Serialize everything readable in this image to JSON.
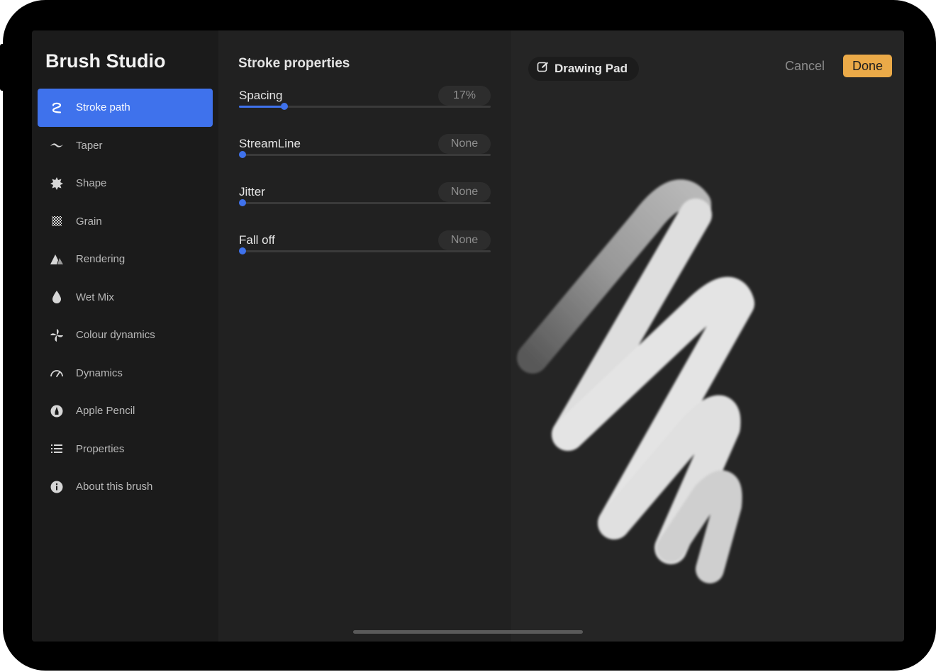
{
  "sidebar": {
    "title": "Brush Studio",
    "items": [
      {
        "label": "Stroke path",
        "icon": "stroke-path-icon",
        "active": true
      },
      {
        "label": "Taper",
        "icon": "taper-icon"
      },
      {
        "label": "Shape",
        "icon": "shape-icon"
      },
      {
        "label": "Grain",
        "icon": "grain-icon"
      },
      {
        "label": "Rendering",
        "icon": "rendering-icon"
      },
      {
        "label": "Wet Mix",
        "icon": "wet-mix-icon"
      },
      {
        "label": "Colour dynamics",
        "icon": "colour-dynamics-icon"
      },
      {
        "label": "Dynamics",
        "icon": "dynamics-icon"
      },
      {
        "label": "Apple Pencil",
        "icon": "apple-pencil-icon"
      },
      {
        "label": "Properties",
        "icon": "properties-icon"
      },
      {
        "label": "About this brush",
        "icon": "info-icon"
      }
    ]
  },
  "panel": {
    "title": "Stroke properties",
    "properties": [
      {
        "label": "Spacing",
        "value": "17%",
        "level": 0.18
      },
      {
        "label": "StreamLine",
        "value": "None",
        "level": 0
      },
      {
        "label": "Jitter",
        "value": "None",
        "level": 0
      },
      {
        "label": "Fall off",
        "value": "None",
        "level": 0
      }
    ]
  },
  "pad": {
    "label": "Drawing Pad",
    "icon": "edit-icon",
    "cancel": "Cancel",
    "done": "Done"
  },
  "colors": {
    "accent": "#3f72ec",
    "done": "#ebaa48",
    "background": "#1d1d1d"
  }
}
